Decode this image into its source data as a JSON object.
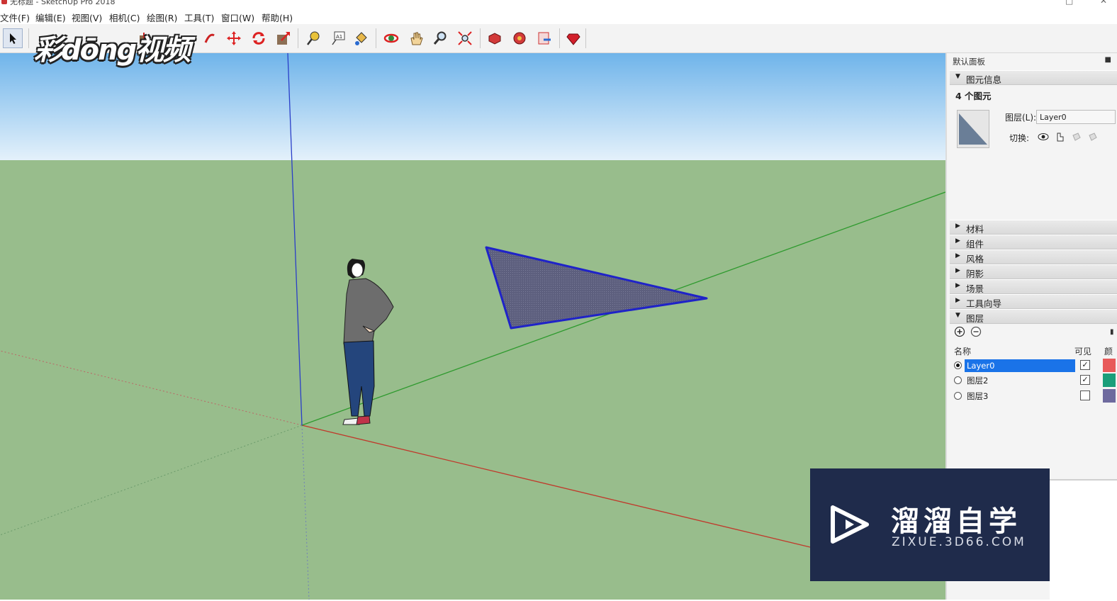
{
  "window": {
    "title": "无标题 - SketchUp Pro 2018"
  },
  "menu": [
    "文件(F)",
    "编辑(E)",
    "视图(V)",
    "相机(C)",
    "绘图(R)",
    "工具(T)",
    "窗口(W)",
    "帮助(H)"
  ],
  "overlay_logo": "彩dōng视频",
  "tray": {
    "title": "默认面板",
    "entity_info": {
      "header": "图元信息",
      "count": "4 个图元",
      "layer_label": "图层(L):",
      "layer_value": "Layer0",
      "toggle_label": "切换:"
    },
    "sections": [
      "材料",
      "组件",
      "风格",
      "阴影",
      "场景",
      "工具向导"
    ],
    "layers_header": "图层",
    "layers": {
      "columns": {
        "name": "名称",
        "visible": "可见",
        "color": "颜"
      },
      "rows": [
        {
          "name": "Layer0",
          "active": true,
          "visible": true,
          "color": "#e85a5a"
        },
        {
          "name": "图层2",
          "active": false,
          "visible": true,
          "color": "#1a9e7a"
        },
        {
          "name": "图层3",
          "active": false,
          "visible": false,
          "color": "#6e6a9e"
        }
      ]
    }
  },
  "watermark": {
    "name": "溜溜自学",
    "url": "ZIXUE.3D66.COM"
  },
  "colors": {
    "sky_top": "#6fb4ea",
    "sky_bottom": "#e4f1fb",
    "ground": "#98bd8c",
    "face": "#5d5f7e",
    "edge": "#1f23c8",
    "accent": "#1a73e8"
  }
}
